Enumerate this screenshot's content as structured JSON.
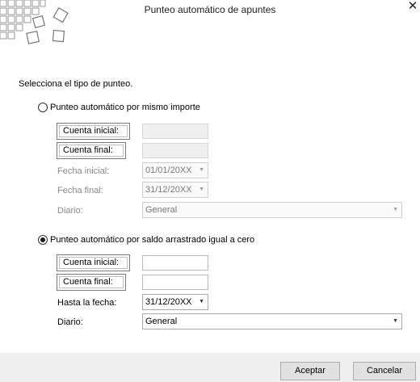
{
  "window": {
    "title": "Punteo automático de apuntes",
    "close_symbol": "✕"
  },
  "prompt": "Selecciona el tipo de punteo.",
  "option1": {
    "label": "Punteo automático por mismo importe",
    "selected": false,
    "cuenta_inicial": {
      "label": "Cuenta inicial:",
      "value": ""
    },
    "cuenta_final": {
      "label": "Cuenta final:",
      "value": ""
    },
    "fecha_inicial": {
      "label": "Fecha inicial:",
      "value": "01/01/20XX"
    },
    "fecha_final": {
      "label": "Fecha final:",
      "value": "31/12/20XX"
    },
    "diario": {
      "label": "Diario:",
      "value": "General"
    }
  },
  "option2": {
    "label": "Punteo automático por saldo arrastrado igual a cero",
    "selected": true,
    "cuenta_inicial": {
      "label": "Cuenta inicial:",
      "value": ""
    },
    "cuenta_final": {
      "label": "Cuenta final:",
      "value": ""
    },
    "hasta_fecha": {
      "label": "Hasta la fecha:",
      "value": "31/12/20XX"
    },
    "diario": {
      "label": "Diario:",
      "value": "General"
    }
  },
  "buttons": {
    "ok": "Aceptar",
    "cancel": "Cancelar"
  },
  "icons": {
    "dropdown_arrow": "▼"
  },
  "colors": {
    "footer_bg": "#f0f0f0",
    "disabled_text": "#8a8a8a",
    "button_bg": "#e1e1e1"
  }
}
